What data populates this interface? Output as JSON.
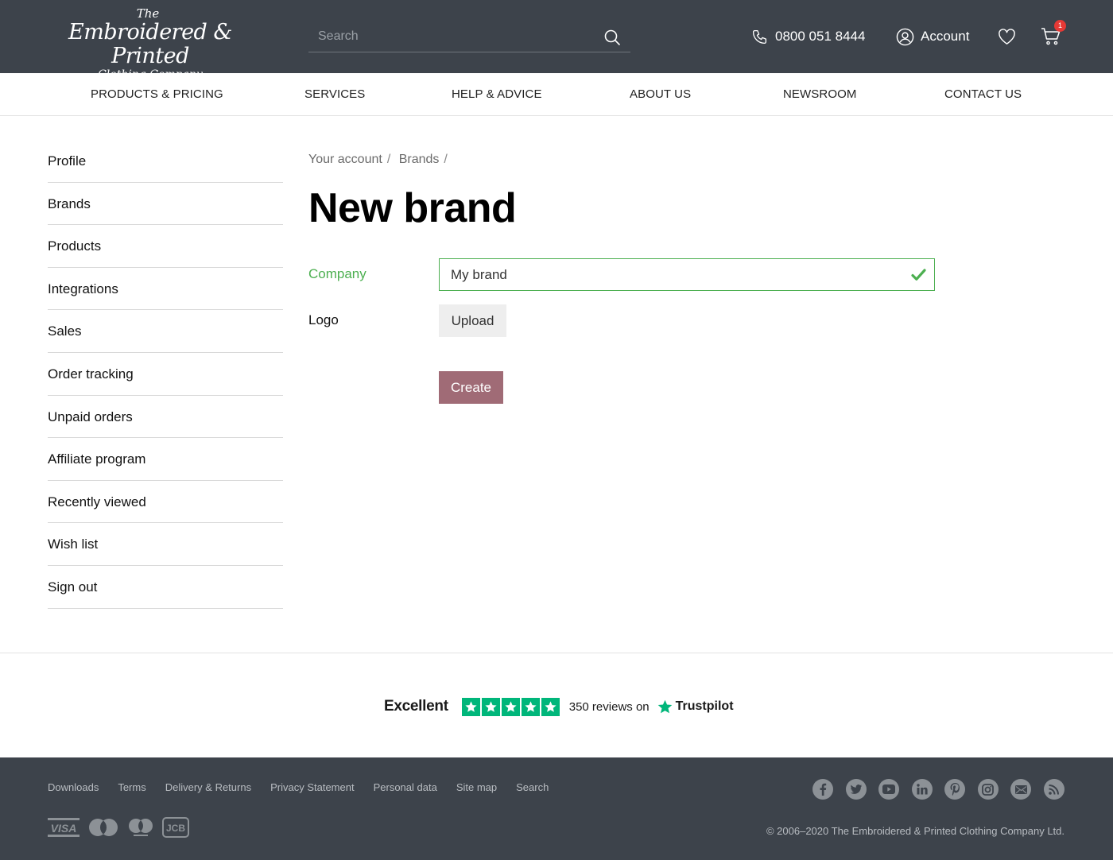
{
  "header": {
    "logo": {
      "the": "The",
      "main": "Embroidered & Printed",
      "sub": "Clothing Company"
    },
    "search_placeholder": "Search",
    "phone": "0800 051 8444",
    "account_label": "Account",
    "cart_count": "1"
  },
  "nav": [
    "PRODUCTS & PRICING",
    "SERVICES",
    "HELP & ADVICE",
    "ABOUT US",
    "NEWSROOM",
    "CONTACT US"
  ],
  "sidebar": [
    "Profile",
    "Brands",
    "Products",
    "Integrations",
    "Sales",
    "Order tracking",
    "Unpaid orders",
    "Affiliate program",
    "Recently viewed",
    "Wish list",
    "Sign out"
  ],
  "breadcrumb": [
    "Your account",
    "Brands"
  ],
  "page_title": "New brand",
  "form": {
    "company_label": "Company",
    "company_value": "My brand",
    "logo_label": "Logo",
    "upload_label": "Upload",
    "create_label": "Create"
  },
  "trustpilot": {
    "rating_word": "Excellent",
    "reviews_text": "350 reviews on",
    "brand": "Trustpilot",
    "stars": 5
  },
  "footer": {
    "links": [
      "Downloads",
      "Terms",
      "Delivery & Returns",
      "Privacy Statement",
      "Personal data",
      "Site map",
      "Search"
    ],
    "social_icons": [
      "facebook-icon",
      "twitter-icon",
      "youtube-icon",
      "linkedin-icon",
      "pinterest-icon",
      "instagram-icon",
      "email-icon",
      "rss-icon"
    ],
    "payments": [
      "VISA",
      "JCB"
    ],
    "copyright": "© 2006–2020  The Embroidered & Printed Clothing Company Ltd."
  },
  "colors": {
    "header_bg": "#3d434b",
    "valid_green": "#4caf50",
    "create_button": "#a06b76",
    "trustpilot_green": "#00b67a",
    "badge_red": "#e53935"
  }
}
